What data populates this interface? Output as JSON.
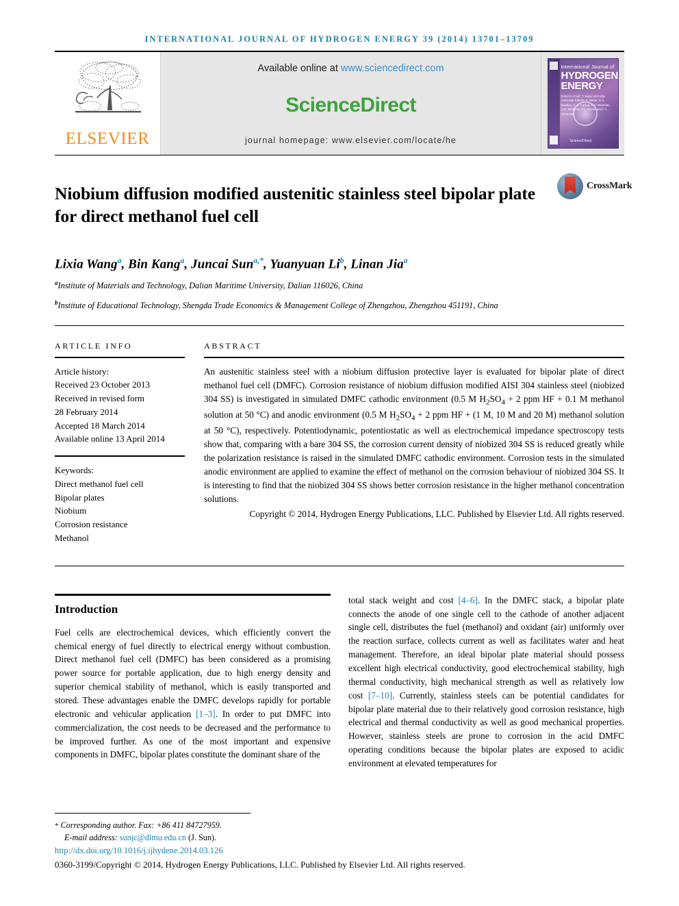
{
  "running_head": "INTERNATIONAL JOURNAL OF HYDROGEN ENERGY 39 (2014) 13701–13709",
  "masthead": {
    "available_prefix": "Available online at ",
    "sciencedirect_url": "www.sciencedirect.com",
    "sciencedirect_wordmark": "ScienceDirect",
    "journal_homepage": "journal homepage: www.elsevier.com/locate/he",
    "publisher_name": "ELSEVIER",
    "cover": {
      "line1": "International Journal of",
      "line2": "HYDROGEN",
      "line3": "ENERGY",
      "editors": "Editor-in-Chief:  T. Nejat Veziroğlu\nAssociate Editors:  A. Bahar, D.S. Dunikov, A. A. Correa,\nA.C. Bhandari, J.W. Sheffield,\nD.L. Cocke and F.A. Armavalle",
      "sciencedirect_mark": "ScienceDirect",
      "society_mark": "IJHE"
    }
  },
  "article": {
    "title": "Niobium diffusion modified austenitic stainless steel bipolar plate for direct methanol fuel cell",
    "crossmark_label": "CrossMark",
    "authors_html": "Lixia Wang<sup>a</sup>, Bin Kang<sup>a</sup>, Juncai Sun<sup>a,*</sup>, Yuanyuan Li<sup>b</sup>, Linan Jia<sup>a</sup>",
    "affiliations": [
      {
        "marker": "a",
        "text": "Institute of Materials and Technology, Dalian Maritime University, Dalian 116026, China"
      },
      {
        "marker": "b",
        "text": "Institute of Educational Technology, Shengda Trade Economics & Management College of Zhengzhou, Zhengzhou 451191, China"
      }
    ]
  },
  "article_info": {
    "label": "ARTICLE INFO",
    "history_label": "Article history:",
    "history": [
      "Received 23 October 2013",
      "Received in revised form",
      "28 February 2014",
      "Accepted 18 March 2014",
      "Available online 13 April 2014"
    ],
    "keywords_label": "Keywords:",
    "keywords": [
      "Direct methanol fuel cell",
      "Bipolar plates",
      "Niobium",
      "Corrosion resistance",
      "Methanol"
    ]
  },
  "abstract": {
    "label": "ABSTRACT",
    "body_html": "An austenitic stainless steel with a niobium diffusion protective layer is evaluated for bipolar plate of direct methanol fuel cell (DMFC). Corrosion resistance of niobium diffusion modified AISI 304 stainless steel (niobized 304 SS) is investigated in simulated DMFC cathodic environment (0.5 M H<sub>2</sub>SO<sub>4</sub> + 2 ppm HF + 0.1 M methanol solution at 50 °C) and anodic environment (0.5 M H<sub>2</sub>SO<sub>4</sub> + 2 ppm HF + (1 M, 10 M and 20 M) methanol solution at 50 °C), respectively. Potentiodynamic, potentiostatic as well as electrochemical impedance spectroscopy tests show that, comparing with a bare 304 SS, the corrosion current density of niobized 304 SS is reduced greatly while the polarization resistance is raised in the simulated DMFC cathodic environment. Corrosion tests in the simulated anodic environment are applied to examine the effect of methanol on the corrosion behaviour of niobized 304 SS. It is interesting to find that the niobized 304 SS shows better corrosion resistance in the higher methanol concentration solutions.",
    "copyright": "Copyright © 2014, Hydrogen Energy Publications, LLC. Published by Elsevier Ltd. All rights reserved."
  },
  "introduction": {
    "title": "Introduction",
    "left_html": "Fuel cells are electrochemical devices, which efficiently convert the chemical energy of fuel directly to electrical energy without combustion. Direct methanol fuel cell (DMFC) has been considered as a promising power source for portable application, due to high energy density and superior chemical stability of methanol, which is easily transported and stored. These advantages enable the DMFC develops rapidly for portable electronic and vehicular application <span class=\"cite\">[1–3]</span>. In order to put DMFC into commercialization, the cost needs to be decreased and the performance to be improved further. As one of the most important and expensive components in DMFC, bipolar plates constitute the dominant share of the",
    "right_html": "total stack weight and cost <span class=\"cite\">[4–6]</span>. In the DMFC stack, a bipolar plate connects the anode of one single cell to the cathode of another adjacent single cell, distributes the fuel (methanol) and oxidant (air) uniformly over the reaction surface, collects current as well as facilitates water and heat management. Therefore, an ideal bipolar plate material should possess excellent high electrical conductivity, good electrochemical stability, high thermal conductivity, high mechanical strength as well as relatively low cost <span class=\"cite\">[7–10]</span>. Currently, stainless steels can be potential candidates for bipolar plate material due to their relatively good corrosion resistance, high electrical and thermal conductivity as well as good mechanical properties. However, stainless steels are prone to corrosion in the acid DMFC operating conditions because the bipolar plates are exposed to acidic environment at elevated temperatures for"
  },
  "footer": {
    "corresponding_star": "*",
    "corresponding_text": "Corresponding author. Fax: +86 411 84727959.",
    "email_label": "E-mail address:",
    "email": "sunjc@dlmu.edu.cn",
    "email_suffix": "(J. Sun).",
    "doi": "http://dx.doi.org/10.1016/j.ijhydene.2014.03.126",
    "copyright": "0360-3199/Copyright © 2014, Hydrogen Energy Publications, LLC. Published by Elsevier Ltd. All rights reserved."
  },
  "colors": {
    "link_blue": "#1a7fad",
    "sciencedirect_green": "#3ea33e",
    "elsevier_orange": "#f08a1e"
  }
}
